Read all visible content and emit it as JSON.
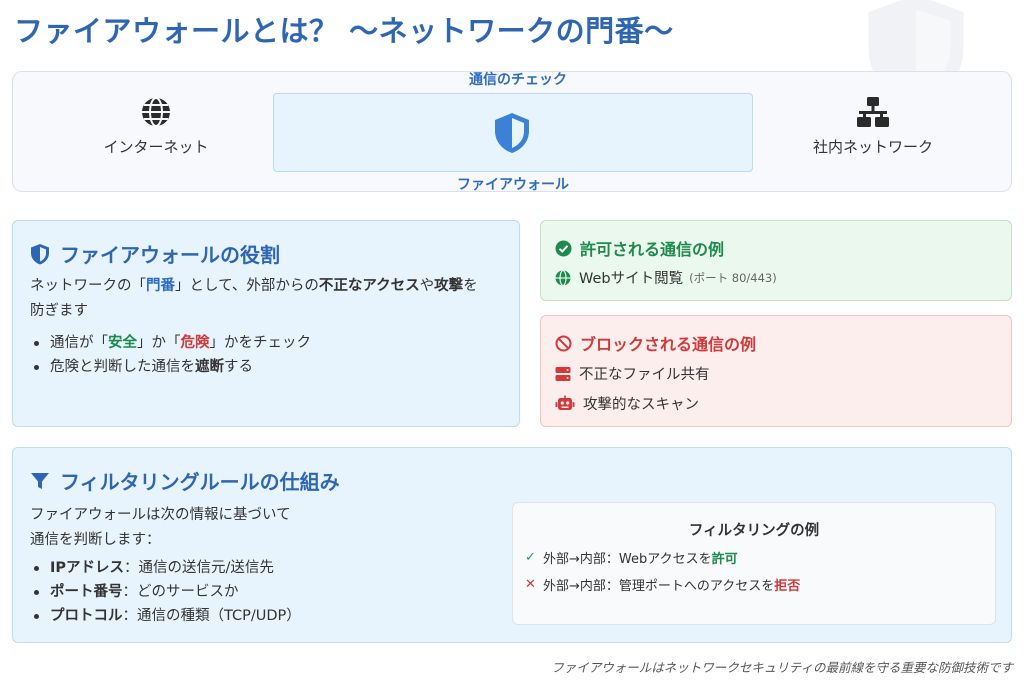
{
  "title": "ファイアウォールとは？ 〜ネットワークの門番〜",
  "diagram": {
    "internet_label": "インターネット",
    "firewall_top_label": "通信のチェック",
    "firewall_bottom_label": "ファイアウォール",
    "lan_label": "社内ネットワーク"
  },
  "role": {
    "heading": "ファイアウォールの役割",
    "intro_1": "ネットワークの「",
    "intro_gate": "門番",
    "intro_2": "」として、外部からの",
    "intro_illegal": "不正なアクセス",
    "intro_3": "や",
    "intro_attack": "攻撃",
    "intro_4": "を",
    "intro_5": "防ぎます",
    "bullet1_a": "通信が「",
    "bullet1_safe": "安全",
    "bullet1_b": "」か「",
    "bullet1_danger": "危険",
    "bullet1_c": "」かをチェック",
    "bullet2_a": "危険と判断した通信を",
    "bullet2_block": "遮断",
    "bullet2_b": "する"
  },
  "allowed": {
    "heading": "許可される通信の例",
    "item1": "Webサイト閲覧",
    "item1_note": "(ポート 80/443)"
  },
  "blocked": {
    "heading": "ブロックされる通信の例",
    "item1": "不正なファイル共有",
    "item2": "攻撃的なスキャン"
  },
  "filtering": {
    "heading": "フィルタリングルールの仕組み",
    "intro_line1": "ファイアウォールは次の情報に基づいて",
    "intro_line2": "通信を判断します：",
    "rules": [
      {
        "term": "IPアドレス",
        "desc": "：通信の送信元/送信先"
      },
      {
        "term": "ポート番号",
        "desc": "：どのサービスか"
      },
      {
        "term": "プロトコル",
        "desc": "：通信の種類（TCP/UDP）"
      }
    ],
    "example": {
      "title": "フィルタリングの例",
      "row1_mark": "✓",
      "row1_text": "外部→内部：Webアクセスを",
      "row1_result": "許可",
      "row2_mark": "✕",
      "row2_text": "外部→内部：管理ポートへのアクセスを",
      "row2_result": "拒否"
    }
  },
  "footer": "ファイアウォールはネットワークセキュリティの最前線を守る重要な防御技術です",
  "colors": {
    "accent_blue": "#2f66b3",
    "allow_green": "#1e8a4c",
    "block_red": "#d03a3a"
  },
  "icons": {
    "internet": "globe-icon",
    "firewall": "shield-icon",
    "lan": "network-icon",
    "allowed": "check-circle-icon",
    "blocked": "ban-icon",
    "web": "globe-icon",
    "file_share": "server-icon",
    "scan": "robot-icon",
    "filter": "filter-icon"
  }
}
